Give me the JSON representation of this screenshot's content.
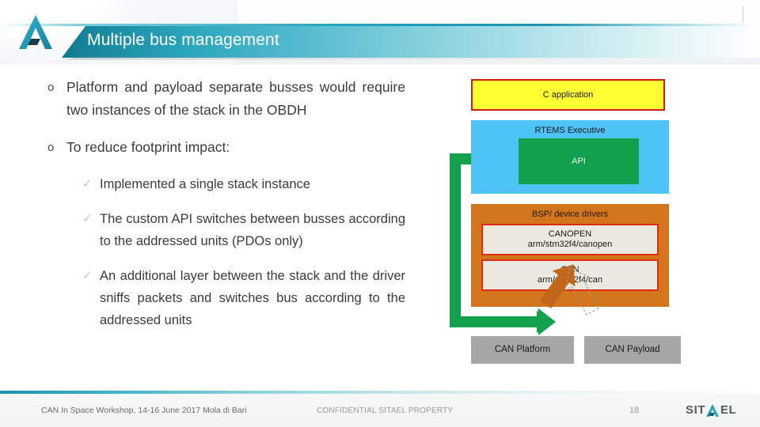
{
  "header": {
    "title": "Multiple bus management",
    "logo_icon": "sitael-a-mark-icon",
    "tick_icon": "top-right-tick-icon"
  },
  "content": {
    "bullets": [
      {
        "marker": "o",
        "marker_icon": "hollow-circle-bullet-icon",
        "text": "Platform and payload separate busses would require two instances of the stack in the OBDH"
      },
      {
        "marker": "o",
        "marker_icon": "hollow-circle-bullet-icon",
        "text": "To reduce footprint impact:"
      }
    ],
    "sub_bullets": [
      {
        "marker": "✓",
        "marker_icon": "checkmark-bullet-icon",
        "text": "Implemented a single stack instance"
      },
      {
        "marker": "✓",
        "marker_icon": "checkmark-bullet-icon",
        "text": "The custom API switches between busses according to the addressed units (PDOs only)"
      },
      {
        "marker": "✓",
        "marker_icon": "checkmark-bullet-icon",
        "text": "An additional layer between the stack and the driver sniffs packets and switches bus according to the addressed units"
      }
    ]
  },
  "diagram": {
    "c_application": "C application",
    "rtems_executive": "RTEMS Executive",
    "api": "API",
    "bsp": "BSP/ device drivers",
    "canopen_title": "CANOPEN",
    "canopen_path": "arm/stm32f4/canopen",
    "can_title": "CAN",
    "can_path": "arm/stm32f4/can",
    "can_platform": "CAN Platform",
    "can_payload": "CAN Payload",
    "arrows": {
      "green_routing_icon": "green-routing-arrow-icon",
      "orange_solid_icon": "orange-solid-arrow-icon",
      "dashed_outline_icon": "dashed-outline-arrow-icon"
    },
    "colors": {
      "c_application_fill": "#ffff33",
      "c_application_border": "#d01e10",
      "rtems_fill": "#4ec3f5",
      "api_fill": "#12a04c",
      "bsp_fill": "#d2751d",
      "driver_fill": "#e9e9df",
      "driver_border": "#e02b12",
      "bus_fill": "#a6a6a6",
      "orange_arrow": "#c1661a"
    }
  },
  "footer": {
    "left": "CAN In Space Workshop, 14-16 June 2017 Mola di Bari",
    "center": "CONFIDENTIAL SITAEL PROPERTY",
    "page": "18",
    "logo_text": "SIT",
    "logo_text_end": "EL",
    "logo_icon": "sitael-a-mark-icon"
  },
  "theme": {
    "accent_dark": "#12798f",
    "accent": "#22a3bd",
    "accent_light": "#8ed4e0",
    "text": "#3b3b3b"
  }
}
